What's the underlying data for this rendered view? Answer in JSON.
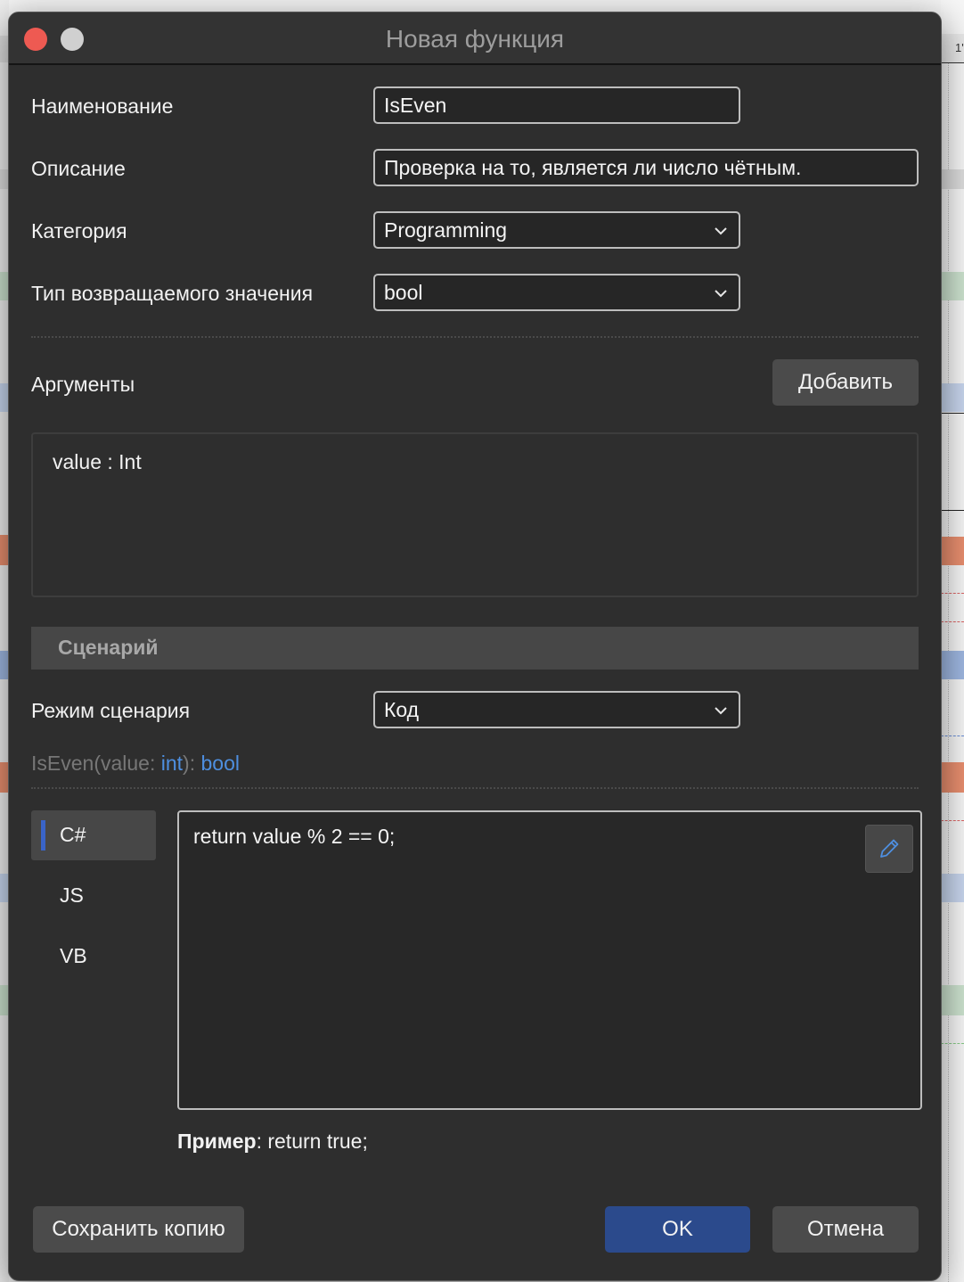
{
  "dialog": {
    "title": "Новая функция"
  },
  "form": {
    "name_label": "Наименование",
    "name_value": "IsEven",
    "description_label": "Описание",
    "description_value": "Проверка на то, является ли число чётным.",
    "category_label": "Категория",
    "category_value": "Programming",
    "return_type_label": "Тип возвращаемого значения",
    "return_type_value": "bool"
  },
  "arguments": {
    "label": "Аргументы",
    "add_button": "Добавить",
    "items": [
      "value : Int"
    ]
  },
  "scenario": {
    "section_title": "Сценарий",
    "mode_label": "Режим сценария",
    "mode_value": "Код",
    "signature": {
      "prefix": "IsEven(value: ",
      "arg_type": "int",
      "middle": "): ",
      "return_type": "bool"
    },
    "languages": [
      "C#",
      "JS",
      "VB"
    ],
    "active_language": "C#",
    "code": "return value % 2 == 0;",
    "example_label": "Пример",
    "example_text": ": return true;"
  },
  "footer": {
    "save_copy": "Сохранить копию",
    "ok": "OK",
    "cancel": "Отмена"
  },
  "background": {
    "header_text": "1'"
  },
  "colors": {
    "dialog_bg": "#2e2e2e",
    "accent_blue": "#2b4a8c",
    "keyword_blue": "#4e8fe0",
    "close_red": "#ee5a52"
  },
  "icons": {
    "edit": "pencil-icon",
    "dropdown": "chevron-down-icon"
  }
}
